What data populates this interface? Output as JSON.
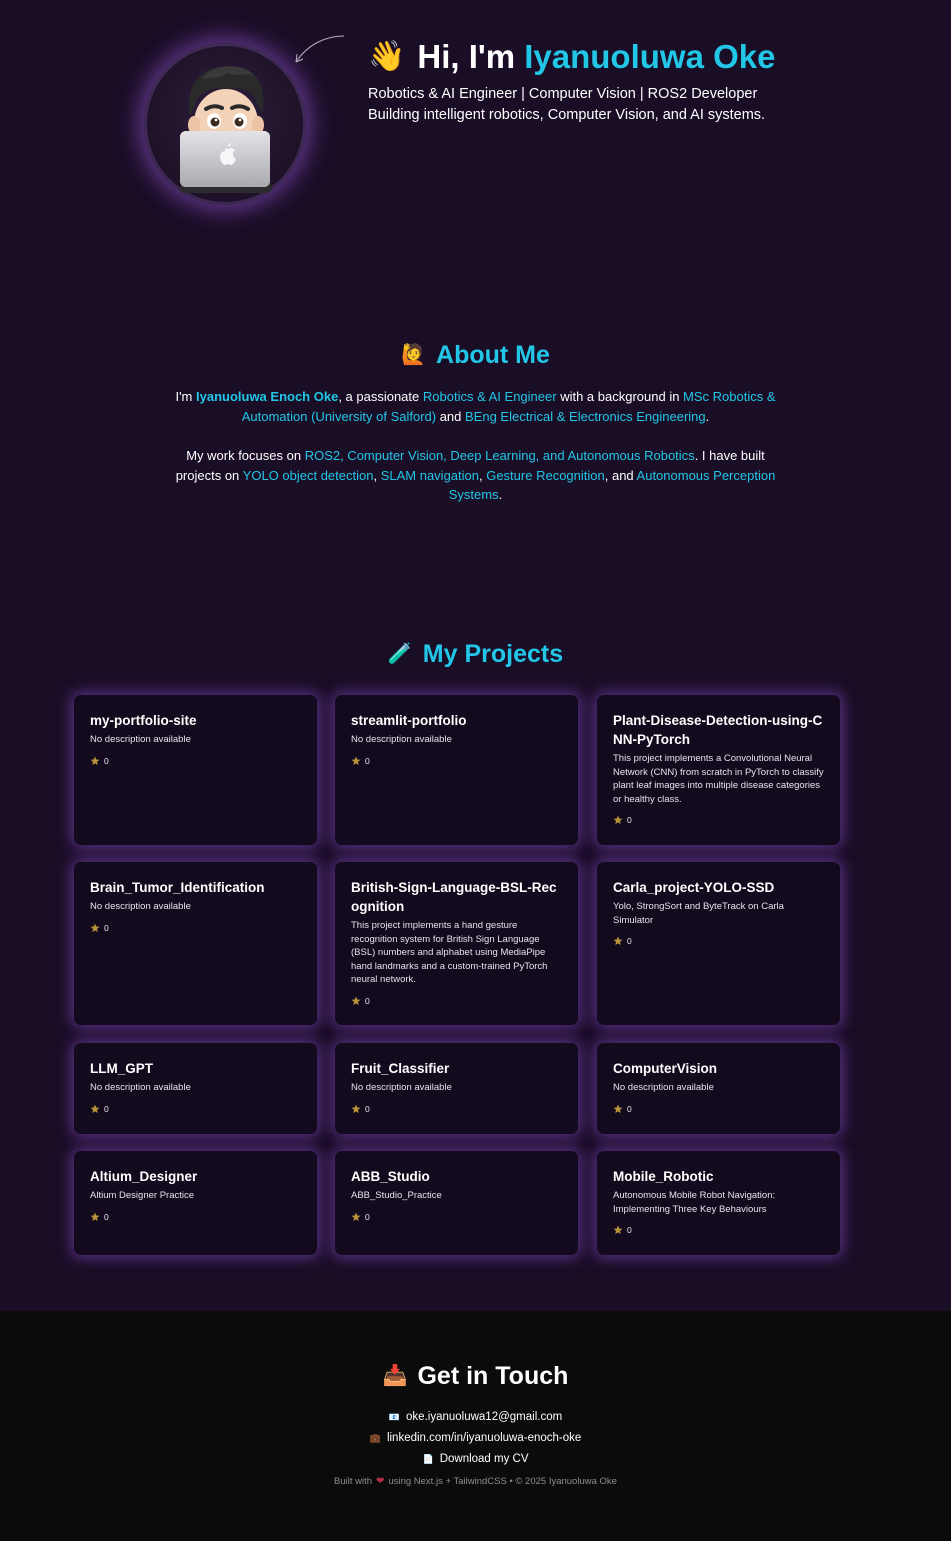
{
  "hero": {
    "wave_icon": "waving-hand-icon",
    "greeting": "Hi, I'm ",
    "name": "Iyanuoluwa Oke",
    "subtitle": "Robotics & AI Engineer | Computer Vision | ROS2 Developer",
    "tagline": "Building intelligent robotics, Computer Vision, and AI systems."
  },
  "about": {
    "title": "About Me",
    "icon": "person-raising-hand-icon",
    "p1": [
      {
        "t": "I'm ",
        "s": "plain"
      },
      {
        "t": "Iyanuoluwa Enoch Oke",
        "s": "bold"
      },
      {
        "t": ", a passionate ",
        "s": "plain"
      },
      {
        "t": "Robotics & AI Engineer",
        "s": "hl"
      },
      {
        "t": " with a background in ",
        "s": "plain"
      },
      {
        "t": "MSc Robotics & Automation (University of Salford)",
        "s": "hl"
      },
      {
        "t": " and ",
        "s": "plain"
      },
      {
        "t": "BEng Electrical & Electronics Engineering",
        "s": "hl"
      },
      {
        "t": ".",
        "s": "plain"
      }
    ],
    "p2": [
      {
        "t": "My work focuses on ",
        "s": "plain"
      },
      {
        "t": "ROS2, Computer Vision, Deep Learning, and Autonomous Robotics",
        "s": "hl"
      },
      {
        "t": ". I have built projects on ",
        "s": "plain"
      },
      {
        "t": "YOLO object detection",
        "s": "hl"
      },
      {
        "t": ", ",
        "s": "plain"
      },
      {
        "t": "SLAM navigation",
        "s": "hl"
      },
      {
        "t": ", ",
        "s": "plain"
      },
      {
        "t": "Gesture Recognition",
        "s": "hl"
      },
      {
        "t": ", and ",
        "s": "plain"
      },
      {
        "t": "Autonomous Perception Systems",
        "s": "hl"
      },
      {
        "t": ".",
        "s": "plain"
      }
    ]
  },
  "projects": {
    "title": "My Projects",
    "icon": "test-tube-icon",
    "items": [
      {
        "name": "my-portfolio-site",
        "desc": "No description available",
        "stars": "0"
      },
      {
        "name": "streamlit-portfolio",
        "desc": "No description available",
        "stars": "0"
      },
      {
        "name": "Plant-Disease-Detection-using-CNN-PyTorch",
        "desc": "This project implements a Convolutional Neural Network (CNN) from scratch in PyTorch to classify plant leaf images into multiple disease categories or healthy class.",
        "stars": "0"
      },
      {
        "name": "Brain_Tumor_Identification",
        "desc": "No description available",
        "stars": "0"
      },
      {
        "name": "British-Sign-Language-BSL-Recognition",
        "desc": "This project implements a hand gesture recognition system for British Sign Language (BSL) numbers and alphabet using MediaPipe hand landmarks and a custom-trained PyTorch neural network.",
        "stars": "0"
      },
      {
        "name": "Carla_project-YOLO-SSD",
        "desc": "Yolo, StrongSort and ByteTrack on Carla Simulator",
        "stars": "0"
      },
      {
        "name": "LLM_GPT",
        "desc": "No description available",
        "stars": "0"
      },
      {
        "name": "Fruit_Classifier",
        "desc": "No description available",
        "stars": "0"
      },
      {
        "name": "ComputerVision",
        "desc": "No description available",
        "stars": "0"
      },
      {
        "name": "Altium_Designer",
        "desc": "Altium Designer Practice",
        "stars": "0"
      },
      {
        "name": "ABB_Studio",
        "desc": "ABB_Studio_Practice",
        "stars": "0"
      },
      {
        "name": "Mobile_Robotic",
        "desc": "Autonomous Mobile Robot Navigation: Implementing Three Key Behaviours",
        "stars": "0"
      }
    ]
  },
  "contact": {
    "title": "Get in Touch",
    "icon": "inbox-tray-icon",
    "email": "oke.iyanuoluwa12@gmail.com",
    "linkedin": "linkedin.com/in/iyanuoluwa-enoch-oke",
    "cv": "Download my CV",
    "footer_pre": "Built with",
    "footer_post": "using Next.js + TailwindCSS • © 2025 Iyanuoluwa Oke"
  },
  "colors": {
    "background": "#1a0d26",
    "accent": "#22c7e8",
    "card": "#130a1e",
    "footer": "#0b0b0b"
  }
}
